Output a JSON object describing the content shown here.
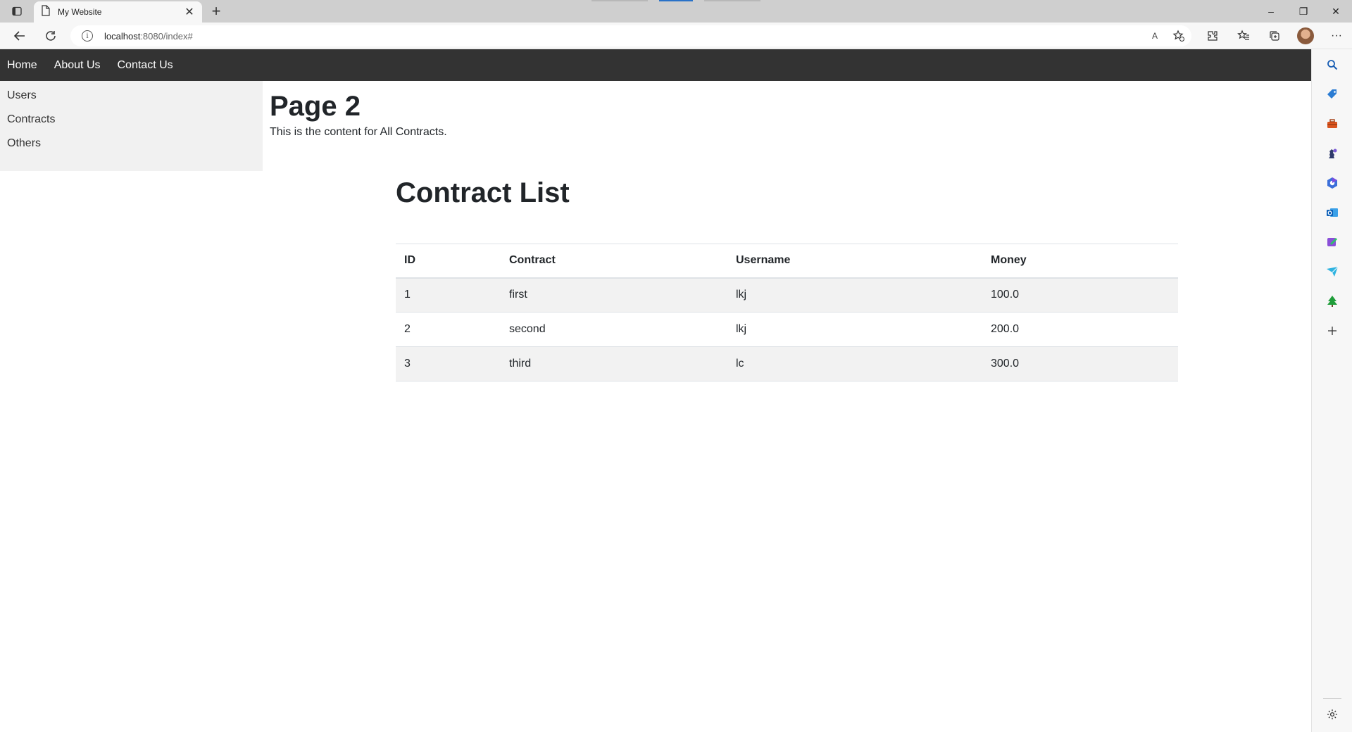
{
  "browser": {
    "tab_title": "My Website",
    "new_tab_symbol": "+",
    "url_host": "localhost",
    "url_path": ":8080/index#",
    "window": {
      "minimize": "–",
      "restore": "❐",
      "close": "✕"
    },
    "read_aloud": "A",
    "more": "···"
  },
  "nav": {
    "items": [
      {
        "label": "Home"
      },
      {
        "label": "About Us"
      },
      {
        "label": "Contact Us"
      }
    ]
  },
  "sidebar": {
    "items": [
      {
        "label": "Users"
      },
      {
        "label": "Contracts"
      },
      {
        "label": "Others"
      }
    ]
  },
  "page": {
    "title": "Page 2",
    "description": "This is the content for All Contracts."
  },
  "contracts": {
    "heading": "Contract List",
    "columns": [
      "ID",
      "Contract",
      "Username",
      "Money"
    ],
    "rows": [
      {
        "id": "1",
        "contract": "first",
        "username": "lkj",
        "money": "100.0"
      },
      {
        "id": "2",
        "contract": "second",
        "username": "lkj",
        "money": "200.0"
      },
      {
        "id": "3",
        "contract": "third",
        "username": "lc",
        "money": "300.0"
      }
    ]
  },
  "edge_sidebar": {
    "icons": [
      "search-icon",
      "shopping-tag-icon",
      "toolbox-icon",
      "chess-icon",
      "office-icon",
      "outlook-icon",
      "designer-icon",
      "send-icon",
      "tree-icon",
      "add-icon",
      "settings-icon"
    ]
  },
  "colors": {
    "navbar": "#333333",
    "sidebar": "#f1f1f1",
    "striped_row": "#f2f2f2"
  }
}
